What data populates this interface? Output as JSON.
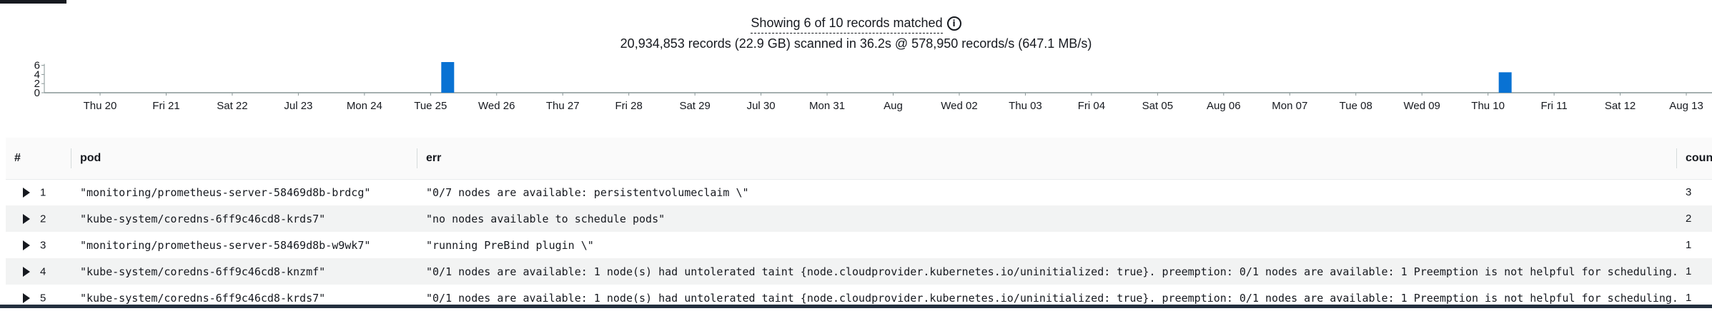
{
  "summary": {
    "line1": "Showing 6 of 10 records matched",
    "line2": "20,934,853 records (22.9 GB) scanned in 36.2s @ 578,950 records/s (647.1 MB/s)"
  },
  "colors": {
    "bar": "#0972d3",
    "axis": "#879596",
    "text": "#16191f"
  },
  "chart_data": {
    "type": "bar",
    "title": "",
    "xlabel": "",
    "ylabel": "",
    "ylim": [
      0,
      6
    ],
    "yticks": [
      "6",
      "4",
      "2",
      "0"
    ],
    "categories": [
      "Thu 20",
      "Fri 21",
      "Sat 22",
      "Jul 23",
      "Mon 24",
      "Tue 25",
      "Wed 26",
      "Thu 27",
      "Fri 28",
      "Sat 29",
      "Jul 30",
      "Mon 31",
      "Aug",
      "Wed 02",
      "Thu 03",
      "Fri 04",
      "Sat 05",
      "Aug 06",
      "Mon 07",
      "Tue 08",
      "Wed 09",
      "Thu 10",
      "Fri 11",
      "Sat 12",
      "Aug 13"
    ],
    "values": [
      0,
      0,
      0,
      0,
      0,
      6,
      0,
      0,
      0,
      0,
      0,
      0,
      0,
      0,
      0,
      0,
      0,
      0,
      0,
      0,
      0,
      4,
      0,
      0,
      0
    ],
    "grid": false,
    "legend": "none"
  },
  "table": {
    "columns": [
      "#",
      "pod",
      "err",
      "count"
    ],
    "rows": [
      {
        "num": "1",
        "pod": "\"monitoring/prometheus-server-58469d8b-brdcg\"",
        "err": "\"0/7 nodes are available: persistentvolumeclaim \\\"",
        "count": "3"
      },
      {
        "num": "2",
        "pod": "\"kube-system/coredns-6ff9c46cd8-krds7\"",
        "err": "\"no nodes available to schedule pods\"",
        "count": "2"
      },
      {
        "num": "3",
        "pod": "\"monitoring/prometheus-server-58469d8b-w9wk7\"",
        "err": "\"running PreBind plugin \\\"",
        "count": "1"
      },
      {
        "num": "4",
        "pod": "\"kube-system/coredns-6ff9c46cd8-knzmf\"",
        "err": "\"0/1 nodes are available: 1 node(s) had untolerated taint {node.cloudprovider.kubernetes.io/uninitialized: true}. preemption: 0/1 nodes are available: 1 Preemption is not helpful for scheduling..\"",
        "count": "1"
      },
      {
        "num": "5",
        "pod": "\"kube-system/coredns-6ff9c46cd8-krds7\"",
        "err": "\"0/1 nodes are available: 1 node(s) had untolerated taint {node.cloudprovider.kubernetes.io/uninitialized: true}. preemption: 0/1 nodes are available: 1 Preemption is not helpful for scheduling..\"",
        "count": "1"
      }
    ]
  }
}
